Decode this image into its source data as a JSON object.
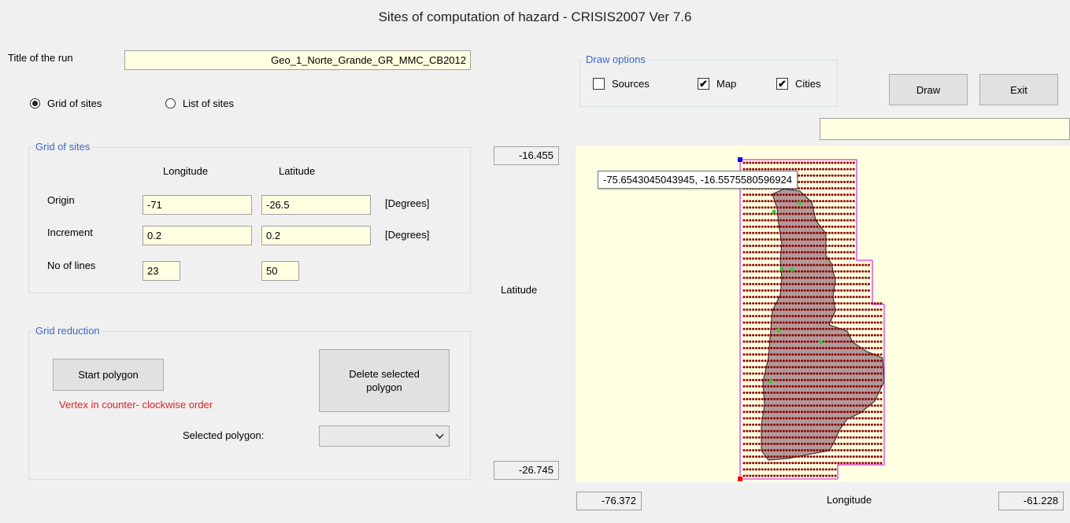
{
  "window": {
    "title": "Sites of computation of hazard - CRISIS2007 Ver 7.6"
  },
  "run": {
    "label": "Title of the run",
    "value": "Geo_1_Norte_Grande_GR_MMC_CB2012"
  },
  "mode": {
    "grid_label": "Grid of sites",
    "list_label": "List of sites",
    "selected": "grid"
  },
  "grid": {
    "title": "Grid of sites",
    "col_longitude": "Longitude",
    "col_latitude": "Latitude",
    "origin_label": "Origin",
    "origin_lon": "-71",
    "origin_lat": "-26.5",
    "increment_label": "Increment",
    "increment_lon": "0.2",
    "increment_lat": "0.2",
    "lines_label": "No of lines",
    "lines_lon": "23",
    "lines_lat": "50",
    "unit": "[Degrees]"
  },
  "reduction": {
    "title": "Grid reduction",
    "start_button": "Start polygon",
    "delete_button": "Delete selected polygon",
    "hint": "Vertex in counter- clockwise order",
    "selected_label": "Selected polygon:",
    "selected_value": ""
  },
  "draw_options": {
    "title": "Draw options",
    "sources_label": "Sources",
    "sources_checked": false,
    "map_label": "Map",
    "map_checked": true,
    "cities_label": "Cities",
    "cities_checked": true
  },
  "buttons": {
    "draw": "Draw",
    "exit": "Exit"
  },
  "status_field": "",
  "axes": {
    "lat_max": "-16.455",
    "lat_min": "-26.745",
    "lat_label": "Latitude",
    "lon_min": "-76.372",
    "lon_max": "-61.228",
    "lon_label": "Longitude"
  },
  "map": {
    "tooltip": "-75.6543045043945, -16.5575580596924",
    "grid_columns": 23,
    "grid_rows": 50,
    "colors": {
      "background": "#ffffe1",
      "dot": "#8b0000",
      "region_fill": "#b39a9a",
      "outline": "#d400d4",
      "city": "#33cc33",
      "marker_top": "#0000ff",
      "marker_bottom": "#ff0000"
    }
  },
  "colors": {
    "accent": "#3a67c7",
    "warning": "#e02020",
    "field_bg": "#ffffe1"
  }
}
